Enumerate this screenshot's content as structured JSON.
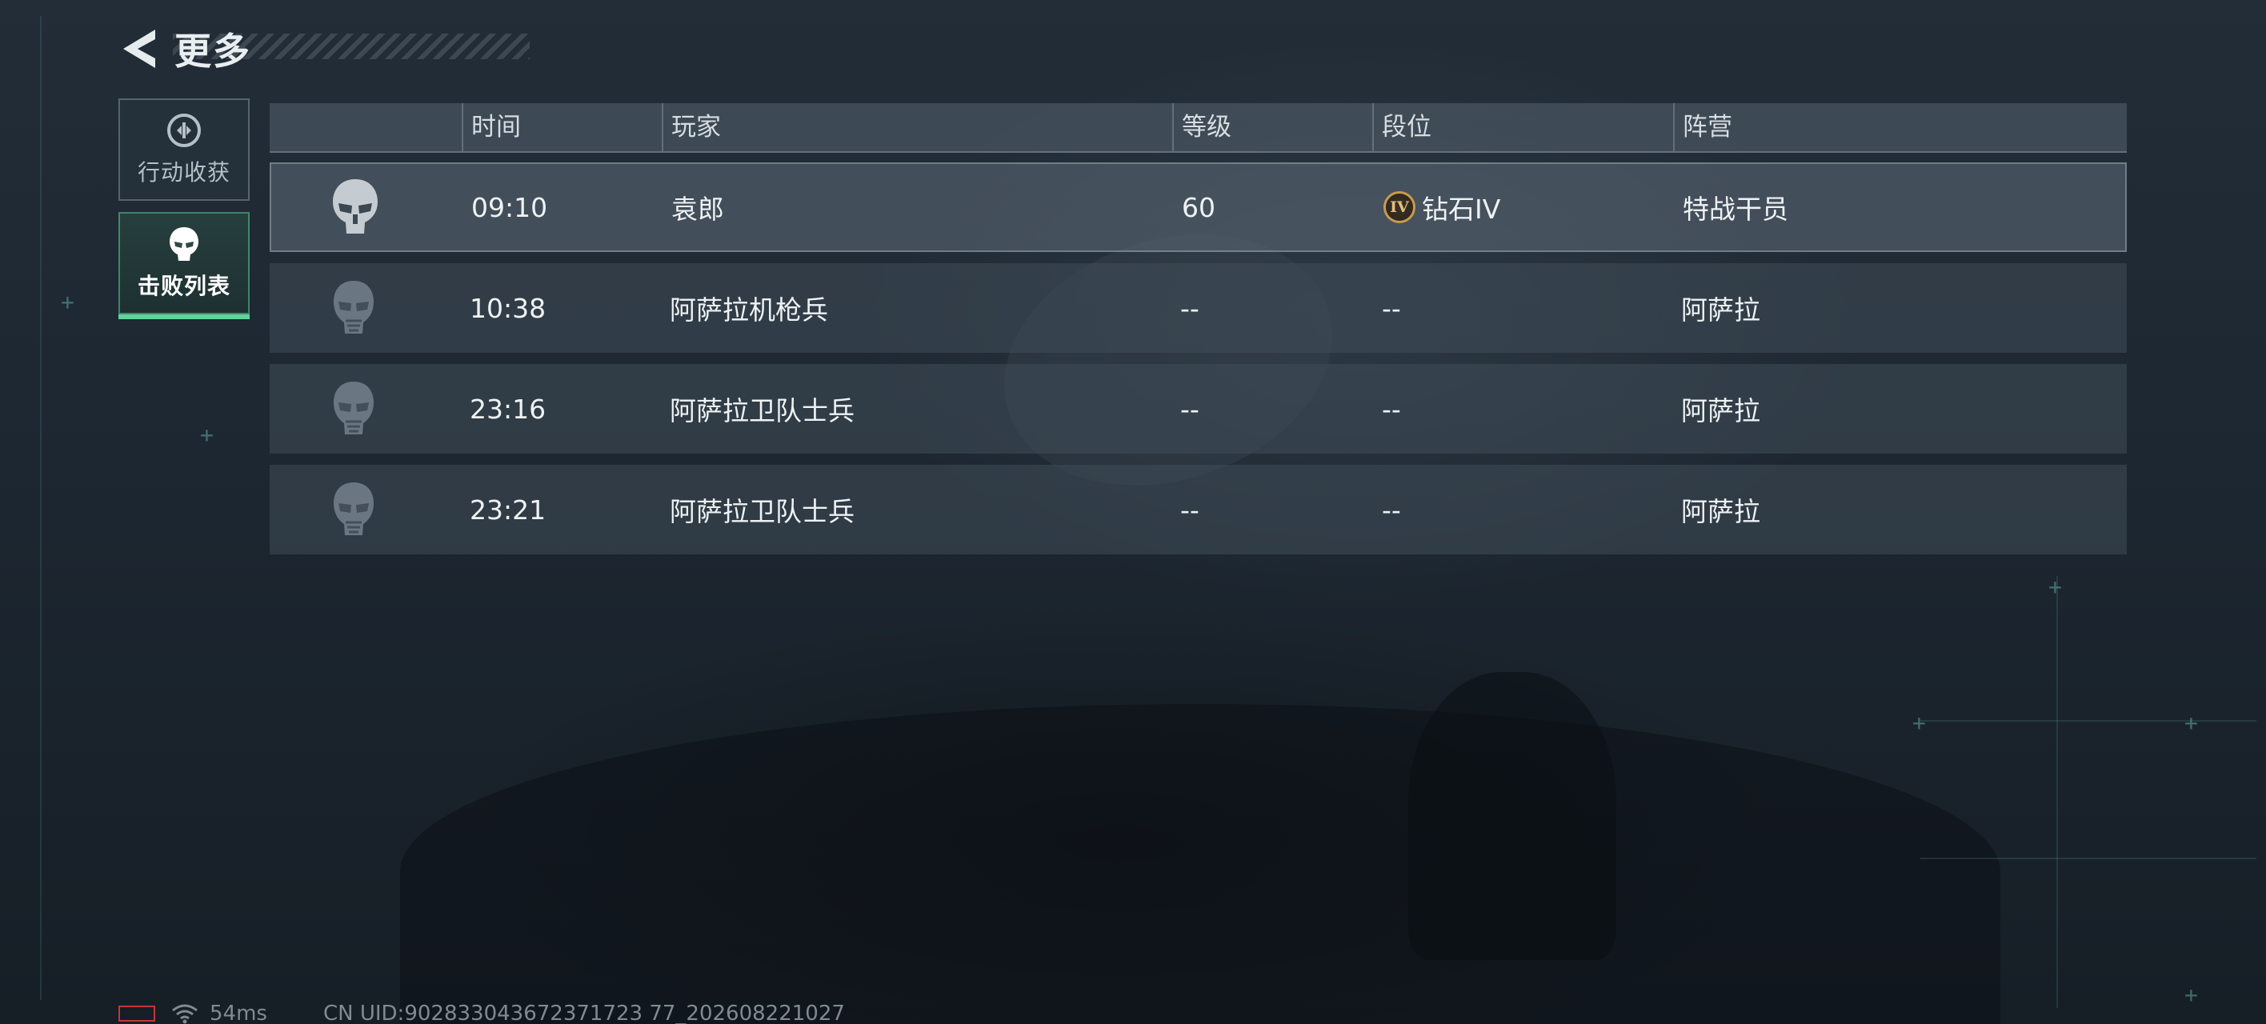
{
  "header": {
    "title": "更多",
    "back_icon": "back-chevron-icon"
  },
  "side_tabs": [
    {
      "label": "行动收获",
      "icon": "loot-icon",
      "active": false
    },
    {
      "label": "击败列表",
      "icon": "skull-mask-icon",
      "active": true
    }
  ],
  "table": {
    "columns": [
      "",
      "时间",
      "玩家",
      "等级",
      "段位",
      "阵营"
    ],
    "rows": [
      {
        "time": "09:10",
        "player": "袁郎",
        "level": "60",
        "rank_badge": "IV",
        "rank": "钻石IV",
        "faction": "特战干员",
        "avatar_icon": "operator-skull-icon"
      },
      {
        "time": "10:38",
        "player": "阿萨拉机枪兵",
        "level": "--",
        "rank": "--",
        "faction": "阿萨拉",
        "avatar_icon": "enemy-mask-icon"
      },
      {
        "time": "23:16",
        "player": "阿萨拉卫队士兵",
        "level": "--",
        "rank": "--",
        "faction": "阿萨拉",
        "avatar_icon": "enemy-mask-icon"
      },
      {
        "time": "23:21",
        "player": "阿萨拉卫队士兵",
        "level": "--",
        "rank": "--",
        "faction": "阿萨拉",
        "avatar_icon": "enemy-mask-icon"
      }
    ]
  },
  "status_bar": {
    "ping": "54ms",
    "uid": "CN UID:902833043672371723 77_202608221027"
  },
  "colors": {
    "accent": "#5fd49a",
    "rank_gold": "#c99a4e",
    "battery_low": "#c23838"
  }
}
